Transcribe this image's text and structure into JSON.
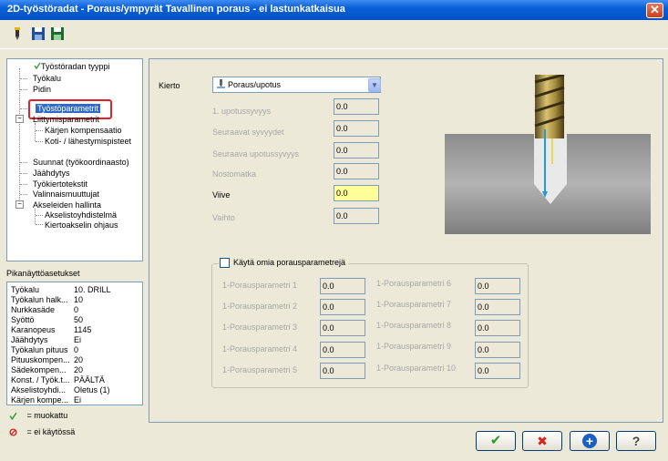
{
  "window": {
    "title": "2D-työstöradat - Poraus/ympyrät Tavallinen poraus - ei lastunkatkaisua",
    "close_glyph": "✕"
  },
  "toolbar": {
    "icons": [
      "tool-icon",
      "save-icon",
      "save-as-icon"
    ]
  },
  "tree": {
    "items": [
      {
        "label": "Työstöradan tyyppi",
        "check": true
      },
      {
        "label": "Työkalu"
      },
      {
        "label": "Pidin"
      },
      {
        "label": "Työstöparametrit",
        "selected": true
      },
      {
        "label": "Liittymisparametrit"
      },
      {
        "label": "Kärjen kompensaatio"
      },
      {
        "label": "Koti- / lähestymispisteet"
      },
      {
        "label": "Suunnat (työkoordinaasto)"
      },
      {
        "label": "Jäähdytys"
      },
      {
        "label": "Työkiertotekstit"
      },
      {
        "label": "Valinnaismuuttujat"
      },
      {
        "label": "Akseleiden hallinta"
      },
      {
        "label": "Akselistoyhdistelmä"
      },
      {
        "label": "Kiertoakselin ohjaus"
      }
    ]
  },
  "quick": {
    "title": "Pikanäyttöasetukset",
    "rows": [
      {
        "label": "Työkalu",
        "value": "10. DRILL"
      },
      {
        "label": "Työkalun halk...",
        "value": "10"
      },
      {
        "label": "Nurkkasäde",
        "value": "0"
      },
      {
        "label": "Syöttö",
        "value": "50"
      },
      {
        "label": "Karanopeus",
        "value": "1145"
      },
      {
        "label": "Jäähdytys",
        "value": "Ei"
      },
      {
        "label": "Työkalun pituus",
        "value": "0"
      },
      {
        "label": "Pituuskompen...",
        "value": "20"
      },
      {
        "label": "Sädekompen...",
        "value": "20"
      },
      {
        "label": "Konst. / Työk.t...",
        "value": "PÄÄLTÄ"
      },
      {
        "label": "Akselistoyhdi...",
        "value": "Oletus (1)"
      },
      {
        "label": "Kärjen kompe...",
        "value": "Ei"
      }
    ]
  },
  "legend": {
    "edited": "= muokattu",
    "disabled": "= ei käytössä"
  },
  "main": {
    "cycle_label": "Kierto",
    "cycle_value": "Poraus/upotus",
    "params": [
      {
        "label": "1. upotussyvyys",
        "value": "0.0",
        "enabled": false
      },
      {
        "label": "Seuraavat syvyydet",
        "value": "0.0",
        "enabled": false
      },
      {
        "label": "Seuraava upotussyvyys",
        "value": "0.0",
        "enabled": false
      },
      {
        "label": "Nostomatka",
        "value": "0.0",
        "enabled": false
      },
      {
        "label": "Viive",
        "value": "0.0",
        "enabled": true
      },
      {
        "label": "Vaihto",
        "value": "0.0",
        "enabled": false
      }
    ],
    "custom_checkbox_label": "Käytä omia porausparametrejä",
    "custom_left": [
      {
        "label": "1-Porausparametri 1",
        "value": "0.0"
      },
      {
        "label": "1-Porausparametri 2",
        "value": "0.0"
      },
      {
        "label": "1-Porausparametri 3",
        "value": "0.0"
      },
      {
        "label": "1-Porausparametri 4",
        "value": "0.0"
      },
      {
        "label": "1-Porausparametri 5",
        "value": "0.0"
      }
    ],
    "custom_right": [
      {
        "label": "1-Porausparametri 6",
        "value": "0.0"
      },
      {
        "label": "1-Porausparametri 7",
        "value": "0.0"
      },
      {
        "label": "1-Porausparametri 8",
        "value": "0.0"
      },
      {
        "label": "1-Porausparametri 9",
        "value": "0.0"
      },
      {
        "label": "1-Porausparametri 10",
        "value": "0.0"
      }
    ]
  },
  "buttons": [
    {
      "name": "ok-button",
      "icon": "check-icon",
      "glyph": "✔",
      "color": "#2e9a2e"
    },
    {
      "name": "cancel-button",
      "icon": "x-icon",
      "glyph": "✖",
      "color": "#d2261f"
    },
    {
      "name": "add-button",
      "icon": "plus-icon",
      "glyph": "+",
      "color": "#1a5fc2"
    },
    {
      "name": "help-button",
      "icon": "question-icon",
      "glyph": "?",
      "color": "#444444"
    }
  ]
}
